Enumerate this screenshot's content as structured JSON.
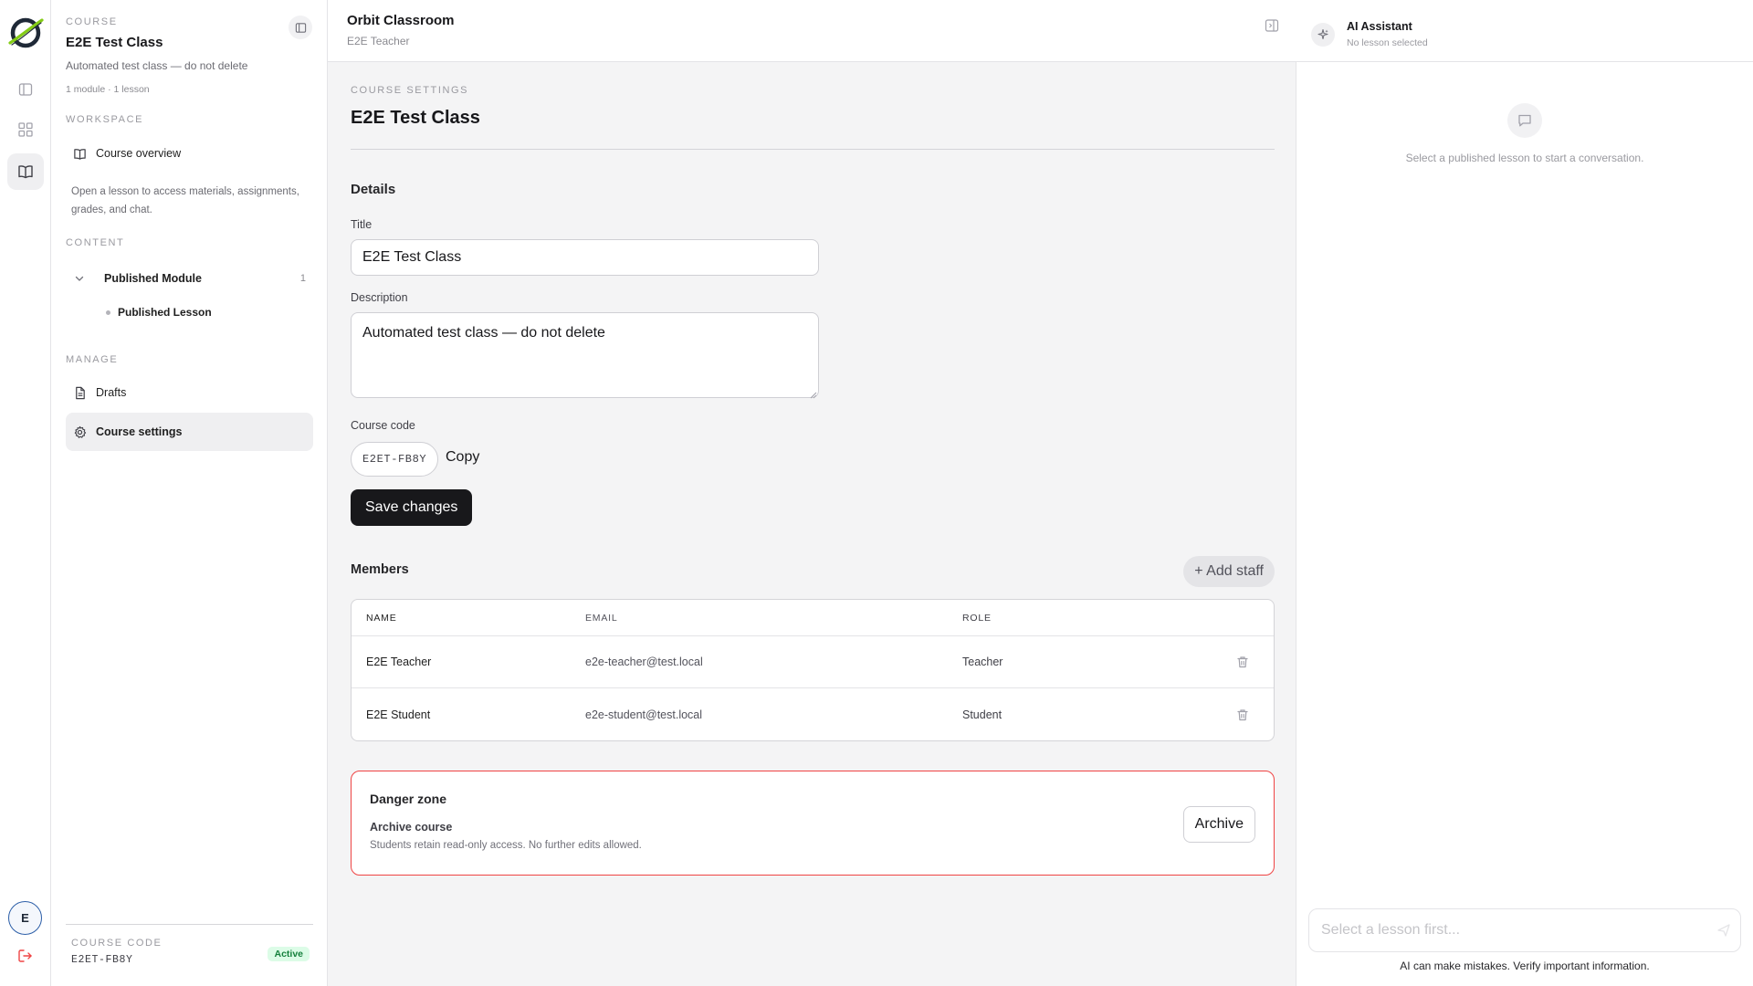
{
  "rail": {
    "avatar_initial": "E"
  },
  "sidebar": {
    "course_eyebrow": "COURSE",
    "course_title": "E2E Test Class",
    "course_description": "Automated test class — do not delete",
    "course_meta": "1 module · 1 lesson",
    "workspace_eyebrow": "WORKSPACE",
    "course_overview_label": "Course overview",
    "hint": "Open a lesson to access materials, assignments, grades, and chat.",
    "content_eyebrow": "CONTENT",
    "module": {
      "label": "Published Module",
      "count": "1"
    },
    "lesson": {
      "label": "Published Lesson"
    },
    "manage_eyebrow": "MANAGE",
    "drafts_label": "Drafts",
    "settings_label": "Course settings",
    "footer": {
      "code_label": "COURSE CODE",
      "code": "E2ET-FB8Y",
      "status": "Active"
    }
  },
  "topbar": {
    "title": "Orbit Classroom",
    "subtitle": "E2E Teacher"
  },
  "settings": {
    "eyebrow": "COURSE SETTINGS",
    "heading": "E2E Test Class",
    "details_title": "Details",
    "title_label": "Title",
    "title_value": "E2E Test Class",
    "description_label": "Description",
    "description_value": "Automated test class — do not delete",
    "code_label": "Course code",
    "code_value": "E2ET-FB8Y",
    "copy_label": "Copy",
    "save_label": "Save changes"
  },
  "members": {
    "title": "Members",
    "add_staff_label": "+ Add staff",
    "columns": {
      "name": "NAME",
      "email": "EMAIL",
      "role": "ROLE"
    },
    "rows": [
      {
        "name": "E2E Teacher",
        "email": "e2e-teacher@test.local",
        "role": "Teacher"
      },
      {
        "name": "E2E Student",
        "email": "e2e-student@test.local",
        "role": "Student"
      }
    ]
  },
  "danger": {
    "title": "Danger zone",
    "archive_title": "Archive course",
    "archive_desc": "Students retain read-only access. No further edits allowed.",
    "archive_button": "Archive"
  },
  "assistant": {
    "title": "AI Assistant",
    "subtitle": "No lesson selected",
    "empty_text": "Select a published lesson to start a conversation.",
    "input_placeholder": "Select a lesson first...",
    "disclaimer": "AI can make mistakes. Verify important information."
  },
  "colors": {
    "accent_dark": "#18181b",
    "danger": "#ef4444",
    "active_badge_bg": "#dcfce7",
    "active_badge_text": "#15803d",
    "logo_green": "#84cc16"
  },
  "icons": {
    "rail": [
      "orbit-logo-icon",
      "sidebar-toggle-icon",
      "grid-icon",
      "book-open-icon",
      "logout-icon"
    ],
    "sidebar": [
      "panel-collapse-icon",
      "book-icon",
      "chevron-down-icon",
      "file-text-icon",
      "gear-icon"
    ],
    "main": [
      "panel-right-icon",
      "trash-icon"
    ],
    "assistant": [
      "sparkle-icon",
      "chat-bubble-icon",
      "send-icon"
    ]
  }
}
